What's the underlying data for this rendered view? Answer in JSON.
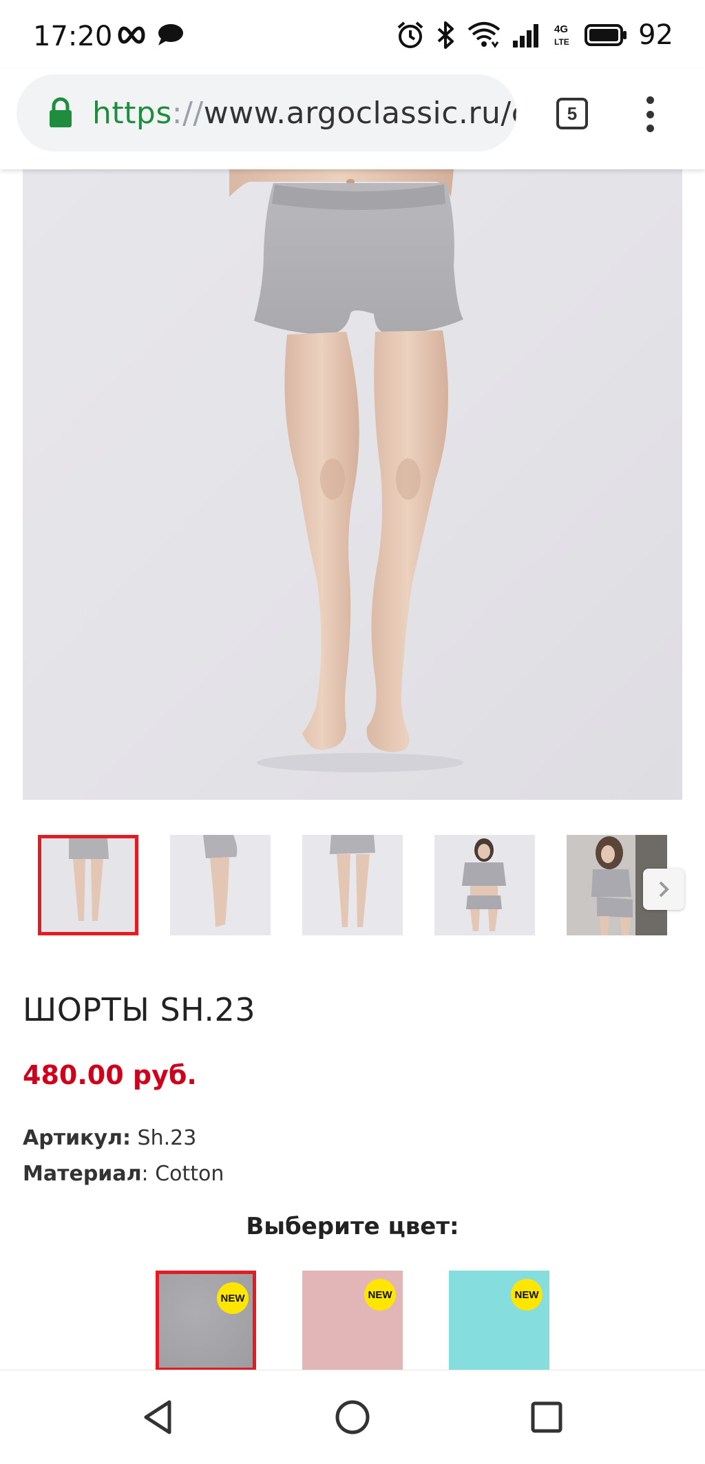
{
  "status_bar": {
    "time": "17:20",
    "battery": "92",
    "icons": [
      "infinity-icon",
      "message-icon",
      "alarm-icon",
      "bluetooth-icon",
      "wifi-icon",
      "signal-icon",
      "lte-icon",
      "battery-icon"
    ]
  },
  "browser": {
    "url_scheme": "https",
    "url_separator": "://",
    "url_rest": "www.argoclassic.ru/c",
    "tab_count": "5"
  },
  "product": {
    "title": "ШОРТЫ SH.23",
    "price": "480.00 руб.",
    "article_label": "Артикул:",
    "article_value": " Sh.23",
    "material_label": "Материал",
    "material_value": ": Cotton",
    "color_heading": "Выберите цвет:"
  },
  "swatches": [
    {
      "badge": "NEW",
      "color": "#a6a6aa",
      "selected": true
    },
    {
      "badge": "NEW",
      "color": "#e2b6b7",
      "selected": false
    },
    {
      "badge": "NEW",
      "color": "#86ddde",
      "selected": false
    }
  ],
  "colors": {
    "accent_red": "#e31b23",
    "price_red": "#d0021b",
    "badge_yellow": "#ffe600",
    "secure_green": "#1e8e3e"
  }
}
